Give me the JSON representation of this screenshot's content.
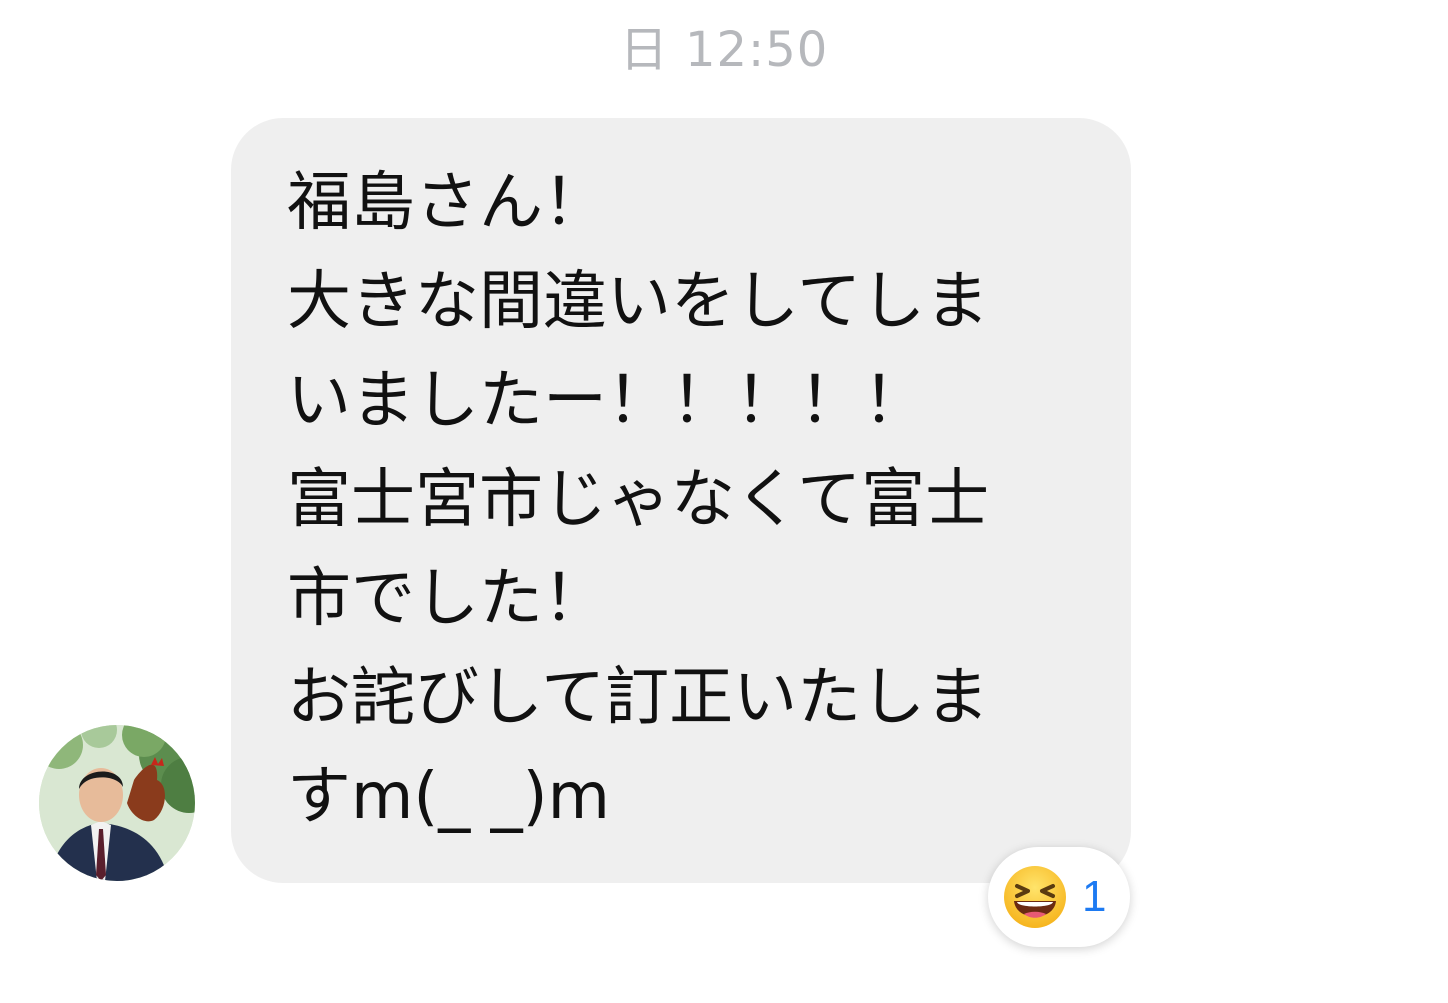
{
  "chat": {
    "timestamp": "日 12:50",
    "message": {
      "lines": [
        "福島さん！",
        "大きな間違いをしてしま",
        "いましたー！！！！！",
        "富士宮市じゃなくて富士",
        "市でした！",
        "お詫びして訂正いたしま",
        "すm(_ _)m"
      ],
      "bubble_color": "#efefef",
      "text_color": "#111111"
    },
    "sender": {
      "avatar_icon": "profile-photo"
    },
    "reaction": {
      "emoji_icon": "grinning-squinting-face-icon",
      "count": "1",
      "count_color": "#1d7af2"
    }
  }
}
